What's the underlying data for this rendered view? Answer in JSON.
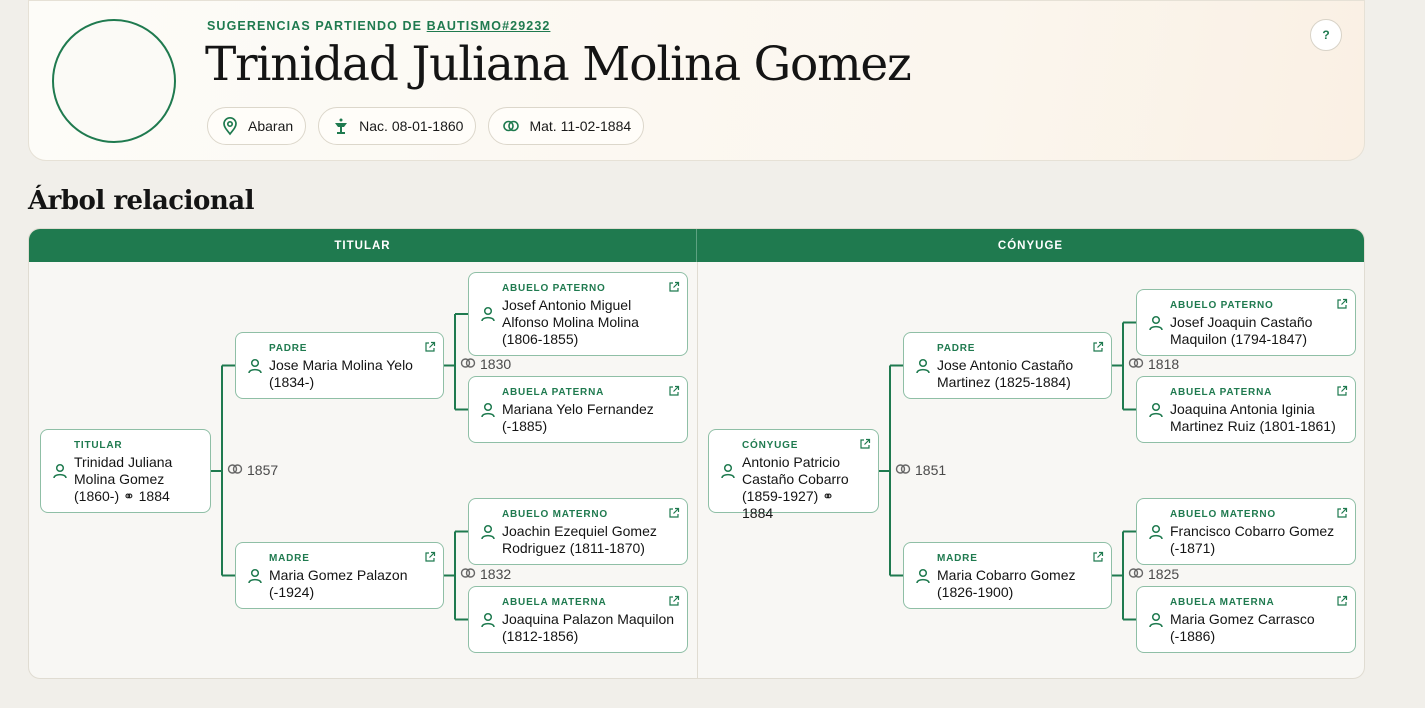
{
  "header": {
    "suggest_prefix": "SUGERENCIAS PARTIENDO DE",
    "suggest_link": "BAUTISMO#29232",
    "name": "Trinidad Juliana Molina Gomez",
    "pills": [
      {
        "icon": "location-pin-icon",
        "label": "Abaran"
      },
      {
        "icon": "baptism-font-icon",
        "label": "Nac. 08-01-1860"
      },
      {
        "icon": "rings-icon",
        "label": "Mat. 11-02-1884"
      }
    ],
    "help_label": "?"
  },
  "section_title": "Árbol relacional",
  "columns": [
    "TITULAR",
    "CÓNYUGE"
  ],
  "tree": {
    "left": {
      "main": {
        "role": "TITULAR",
        "name": "Trinidad Juliana Molina Gomez (1860-) ⚭ 1884"
      },
      "main_union": "1857",
      "father": {
        "role": "PADRE",
        "name": "Jose Maria Molina Yelo (1834-)"
      },
      "mother": {
        "role": "MADRE",
        "name": "Maria Gomez Palazon (-1924)"
      },
      "paternal_union": "1830",
      "maternal_union": "1832",
      "pgf": {
        "role": "ABUELO PATERNO",
        "name": "Josef Antonio Miguel Alfonso Molina Molina (1806-1855)"
      },
      "pgm": {
        "role": "ABUELA PATERNA",
        "name": "Mariana Yelo Fernandez (-1885)"
      },
      "mgf": {
        "role": "ABUELO MATERNO",
        "name": "Joachin Ezequiel Gomez Rodriguez (1811-1870)"
      },
      "mgm": {
        "role": "ABUELA MATERNA",
        "name": "Joaquina Palazon Maquilon (1812-1856)"
      }
    },
    "right": {
      "main": {
        "role": "CÓNYUGE",
        "name": "Antonio Patricio Castaño Cobarro (1859-1927) ⚭ 1884"
      },
      "main_union": "1851",
      "father": {
        "role": "PADRE",
        "name": "Jose Antonio Castaño Martinez (1825-1884)"
      },
      "mother": {
        "role": "MADRE",
        "name": "Maria Cobarro Gomez (1826-1900)"
      },
      "paternal_union": "1818",
      "maternal_union": "1825",
      "pgf": {
        "role": "ABUELO PATERNO",
        "name": "Josef Joaquin Castaño Maquilon (1794-1847)"
      },
      "pgm": {
        "role": "ABUELA PATERNA",
        "name": "Joaquina Antonia Iginia Martinez Ruiz (1801-1861)"
      },
      "mgf": {
        "role": "ABUELO MATERNO",
        "name": "Francisco Cobarro Gomez (-1871)"
      },
      "mgm": {
        "role": "ABUELA MATERNA",
        "name": "Maria Gomez Carrasco (-1886)"
      }
    }
  },
  "colors": {
    "accent": "#1f7a4f",
    "node_border": "#8fbfa6",
    "background": "#f1efea"
  }
}
